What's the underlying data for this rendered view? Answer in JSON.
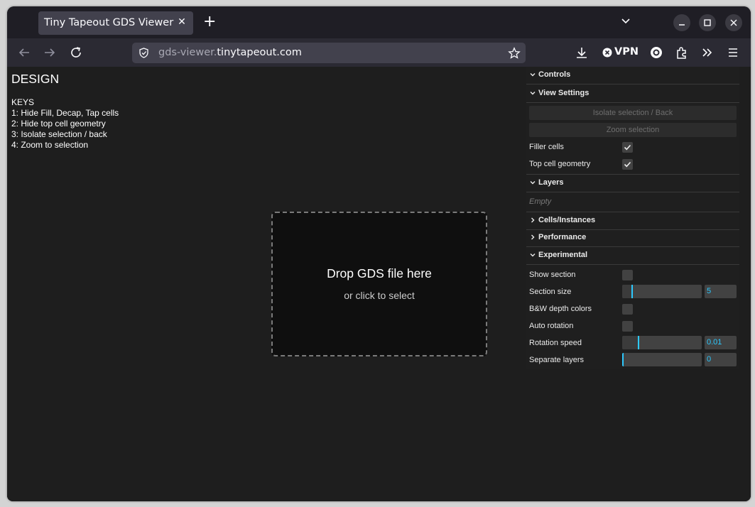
{
  "browser": {
    "tab_title": "Tiny Tapeout GDS Viewer",
    "url_prefix": "gds-viewer.",
    "url_domain": "tinytapeout.com",
    "vpn_label": "VPN"
  },
  "page": {
    "design_title": "DESIGN",
    "keys_title": "KEYS",
    "keys": [
      "1: Hide Fill, Decap, Tap cells",
      "2: Hide top cell geometry",
      "3: Isolate selection / back",
      "4: Zoom to selection"
    ],
    "drop_title": "Drop GDS file here",
    "drop_subtitle": "or click to select"
  },
  "gui": {
    "controls": "Controls",
    "view_settings": "View Settings",
    "isolate_button": "Isolate selection / Back",
    "zoom_button": "Zoom selection",
    "filler_cells": "Filler cells",
    "filler_cells_checked": true,
    "top_cell_geometry": "Top cell geometry",
    "top_cell_geometry_checked": true,
    "layers": "Layers",
    "layers_empty": "Empty",
    "cells_instances": "Cells/Instances",
    "performance": "Performance",
    "experimental": "Experimental",
    "show_section": "Show section",
    "show_section_checked": false,
    "section_size": "Section size",
    "section_size_value": "5",
    "bw_depth_colors": "B&W depth colors",
    "bw_depth_colors_checked": false,
    "auto_rotation": "Auto rotation",
    "auto_rotation_checked": false,
    "rotation_speed": "Rotation speed",
    "rotation_speed_value": "0.01",
    "separate_layers": "Separate layers",
    "separate_layers_value": "0"
  },
  "colors": {
    "accent": "#2cc9ff",
    "page_bg": "#1e1e1e",
    "gui_bg": "#1f1f1f"
  }
}
